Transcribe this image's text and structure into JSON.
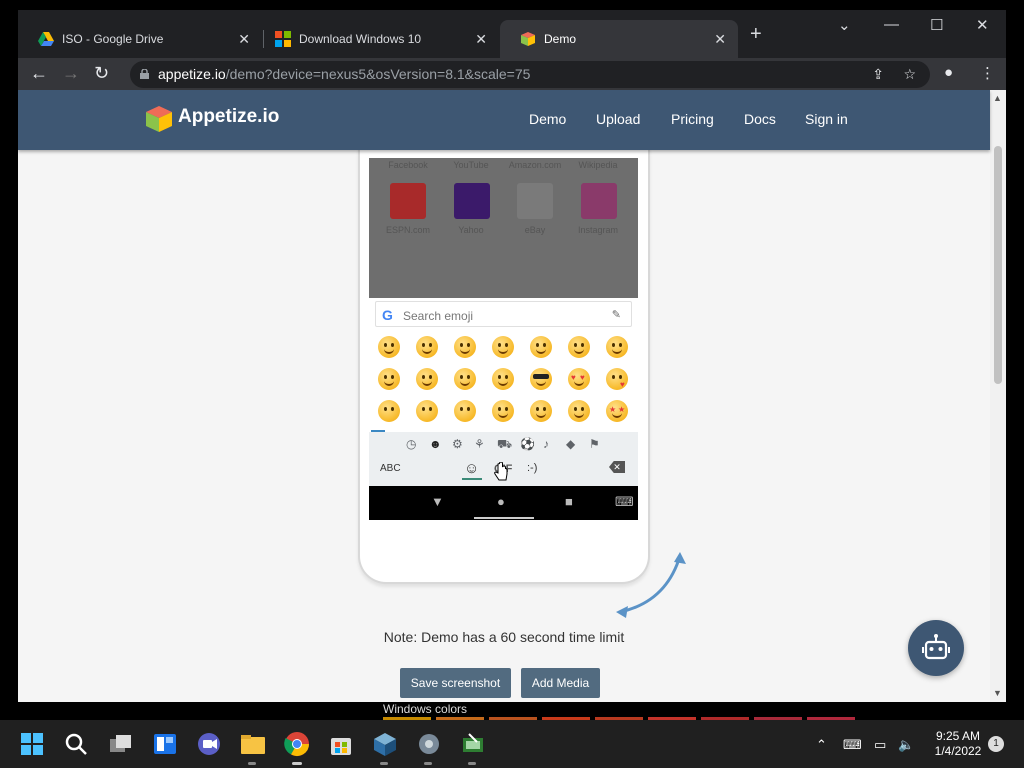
{
  "browser": {
    "tabs": [
      {
        "title": "ISO - Google Drive",
        "favicon": "google-drive-icon"
      },
      {
        "title": "Download Windows 10",
        "favicon": "microsoft-icon"
      },
      {
        "title": "Demo",
        "favicon": "appetize-cube-icon"
      }
    ],
    "url_host": "appetize.io",
    "url_path": "/demo?device=nexus5&osVersion=8.1&scale=75"
  },
  "site": {
    "brand": "Appetize.io",
    "nav": [
      "Demo",
      "Upload",
      "Pricing",
      "Docs",
      "Sign in"
    ]
  },
  "device": {
    "shortcut_labels": [
      "Facebook",
      "YouTube",
      "Amazon.com",
      "Wikipedia"
    ],
    "app_tiles": [
      {
        "label": "ESPN.com",
        "color": "#d2232a"
      },
      {
        "label": "Yahoo",
        "color": "#410093"
      },
      {
        "label": "eBay",
        "color": "#e5e5e5"
      },
      {
        "label": "Instagram",
        "color": "#c13584"
      }
    ],
    "search_placeholder": "Search emoji",
    "keyboard": {
      "abc": "ABC",
      "gif": "GIF",
      "emoticon": ":-)"
    }
  },
  "page": {
    "note": "Note: Demo has a 60 second time limit",
    "save_screenshot": "Save screenshot",
    "add_media": "Add Media",
    "below_fold_heading": "Windows colors"
  },
  "taskbar": {
    "time": "9:25 AM",
    "date": "1/4/2022",
    "notification_count": "1"
  },
  "colors": {
    "site_nav": "#3e5773",
    "button": "#526b80",
    "chrome_dark": "#202124"
  }
}
